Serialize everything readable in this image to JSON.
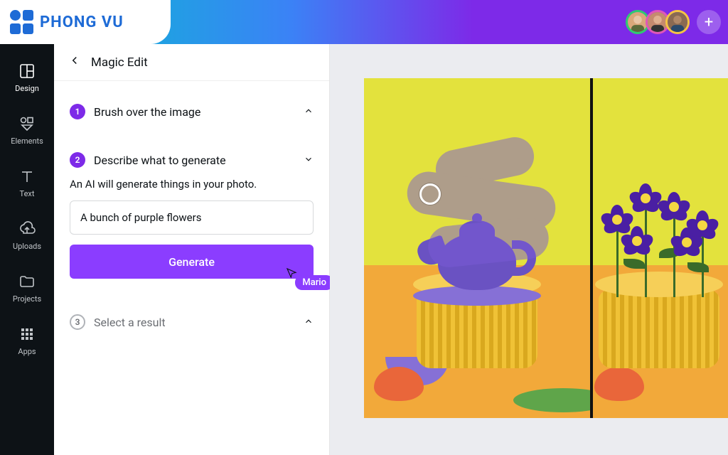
{
  "brand": {
    "name": "PHONG VU"
  },
  "collaborators": [
    {
      "border": "#2ecc71"
    },
    {
      "border": "#e056b8"
    },
    {
      "border": "#f5c542"
    }
  ],
  "rail": [
    {
      "key": "design",
      "label": "Design"
    },
    {
      "key": "elements",
      "label": "Elements"
    },
    {
      "key": "text",
      "label": "Text"
    },
    {
      "key": "uploads",
      "label": "Uploads"
    },
    {
      "key": "projects",
      "label": "Projects"
    },
    {
      "key": "apps",
      "label": "Apps"
    }
  ],
  "panel": {
    "title": "Magic Edit",
    "steps": {
      "s1": {
        "num": "1",
        "title": "Brush over the image"
      },
      "s2": {
        "num": "2",
        "title": "Describe what to generate",
        "desc": "An AI will generate things in your photo."
      },
      "s3": {
        "num": "3",
        "title": "Select a result"
      }
    },
    "prompt_value": "A bunch of purple flowers",
    "generate_label": "Generate",
    "cursor_user": "Mario"
  }
}
